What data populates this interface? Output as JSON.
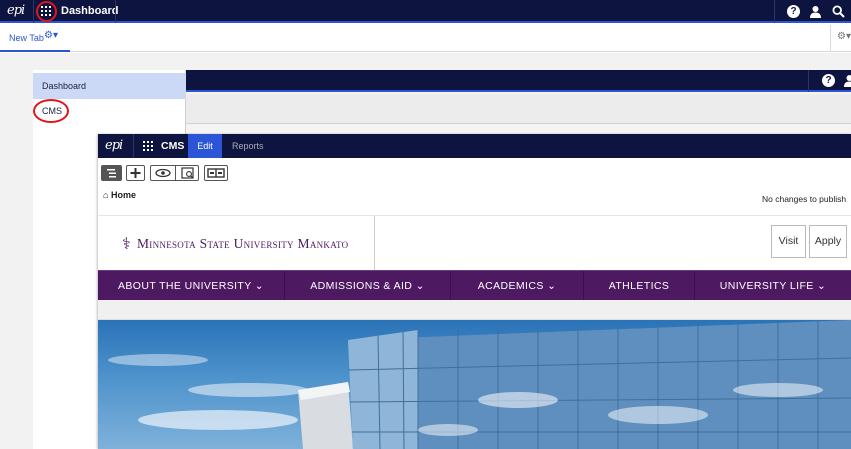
{
  "topbar": {
    "title": "Dashboard"
  },
  "tabbar": {
    "tab_label": "New Tab"
  },
  "menu": {
    "items": [
      {
        "label": "Dashboard"
      },
      {
        "label": "CMS"
      }
    ]
  },
  "cms": {
    "title": "CMS",
    "tabs": [
      {
        "label": "Edit"
      },
      {
        "label": "Reports"
      }
    ],
    "breadcrumb": "Home",
    "publish_status": "No changes to publish",
    "site": {
      "logo_text": "Minnesota State University Mankato",
      "visit_label": "Visit",
      "apply_label": "Apply",
      "nav": [
        {
          "label": "ABOUT THE UNIVERSITY"
        },
        {
          "label": "ADMISSIONS & AID"
        },
        {
          "label": "ACADEMICS"
        },
        {
          "label": "ATHLETICS"
        },
        {
          "label": "UNIVERSITY LIFE"
        }
      ]
    }
  },
  "colors": {
    "nav_bg": "#0e1440",
    "accent": "#2b55d6",
    "brand_purple": "#4d1a61",
    "annotation": "#e0161b"
  }
}
